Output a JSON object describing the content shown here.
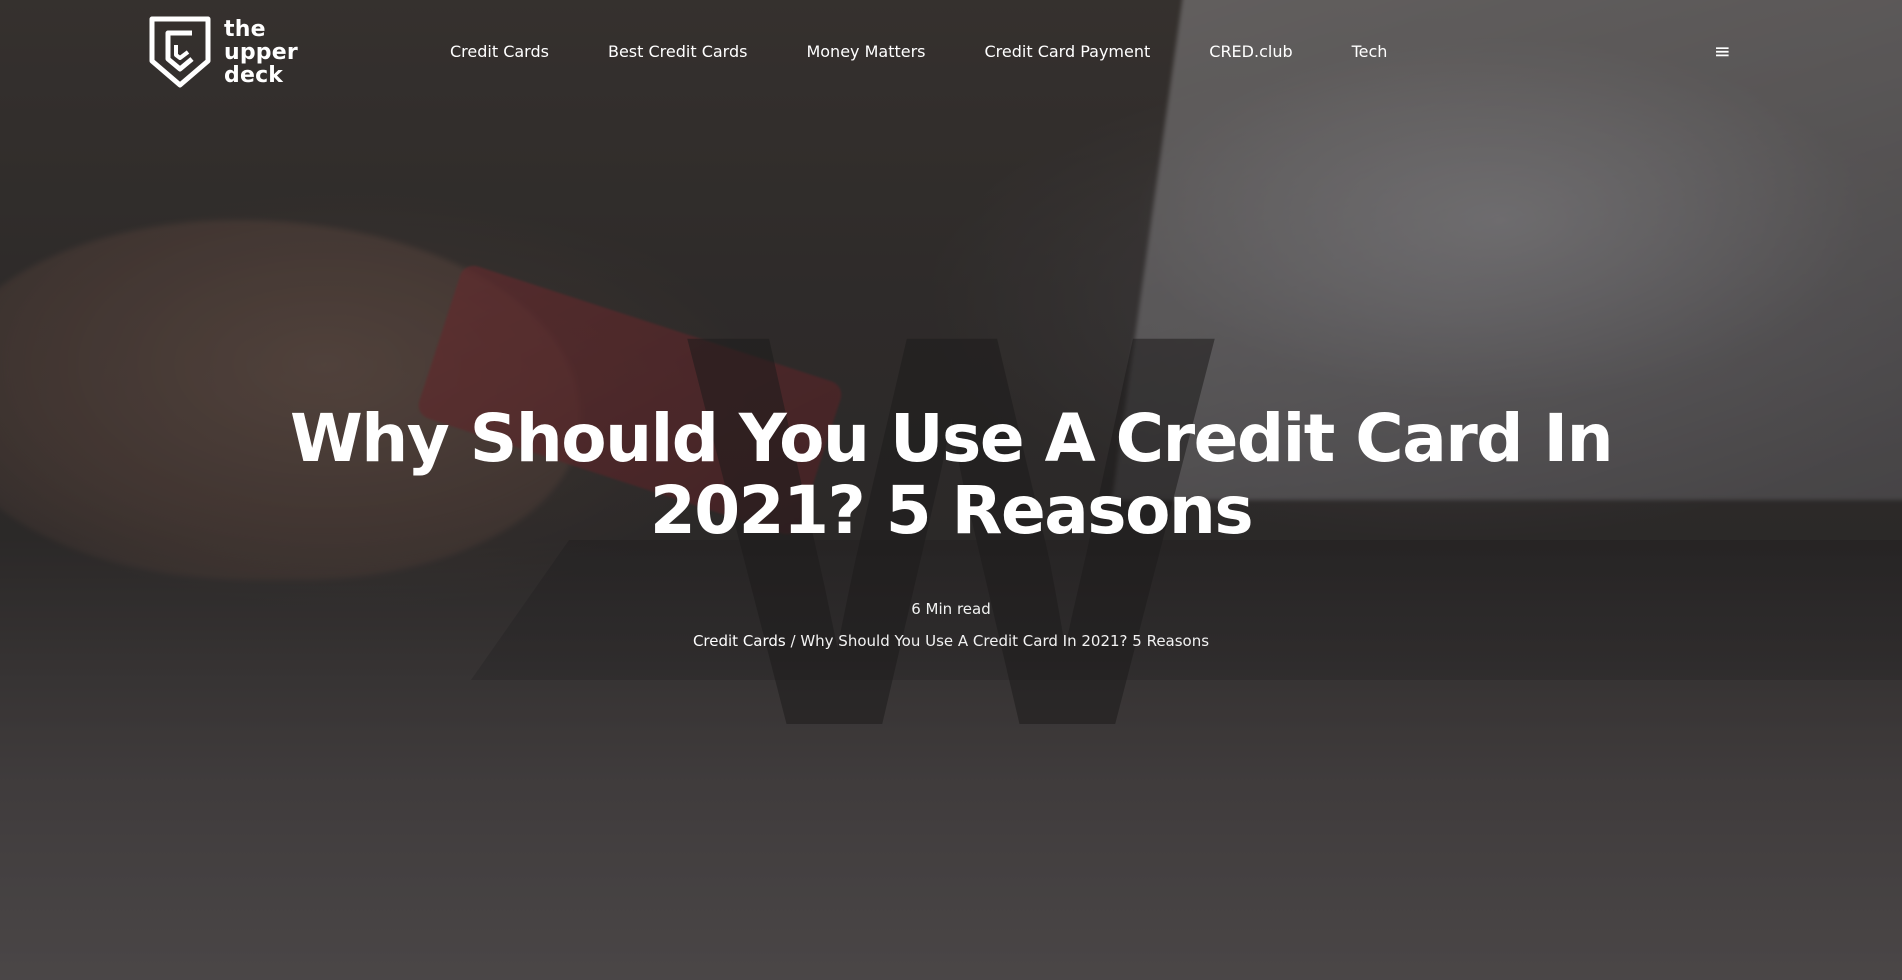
{
  "brand": {
    "logo_line1": "the",
    "logo_line2": "upper",
    "logo_line3": "deck",
    "logo_icon": "shield-c-logo-icon"
  },
  "nav": {
    "items": [
      {
        "label": "Credit Cards"
      },
      {
        "label": "Best Credit Cards"
      },
      {
        "label": "Money Matters"
      },
      {
        "label": "Credit Card Payment"
      },
      {
        "label": "CRED.club"
      },
      {
        "label": "Tech"
      }
    ],
    "menu_icon": "≡"
  },
  "hero": {
    "watermark_letter": "W",
    "title": "Why Should You Use A Credit Card In 2021? 5 Reasons",
    "read_time": "6 Min read",
    "breadcrumb": {
      "category": "Credit Cards",
      "separator": " / ",
      "current": "Why Should You Use A Credit Card In 2021? 5 Reasons"
    }
  },
  "colors": {
    "text": "#ffffff",
    "overlay": "#1a1616"
  }
}
